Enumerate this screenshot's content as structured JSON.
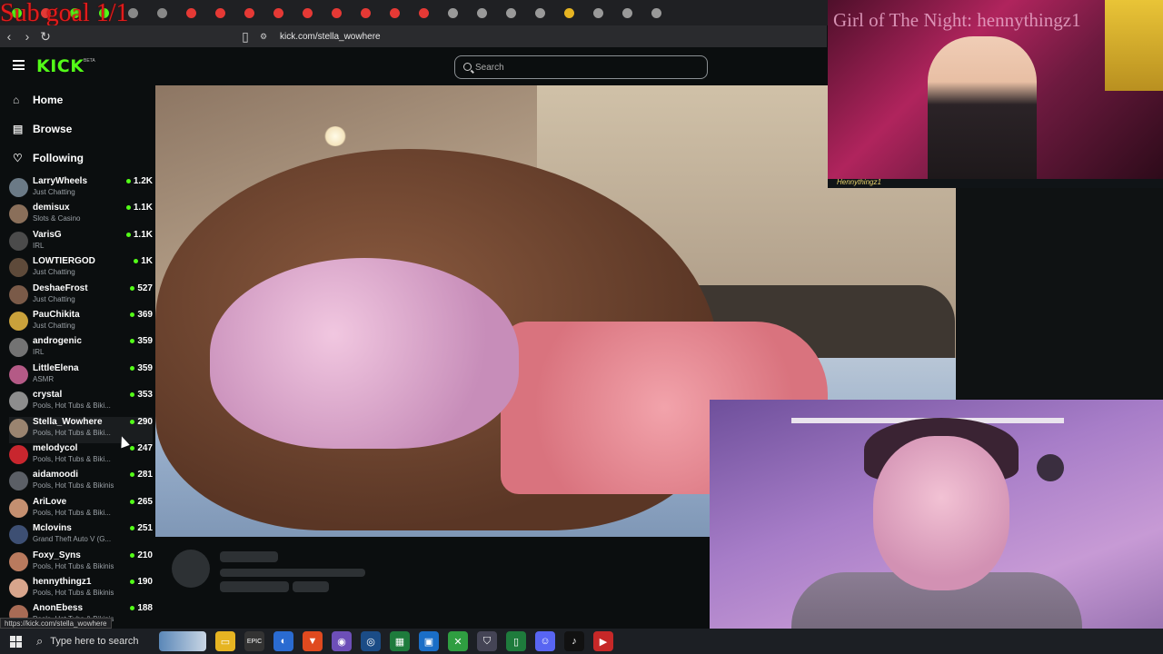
{
  "overlay": {
    "sub_goal": "Sub goal 1/1"
  },
  "browser": {
    "url": "kick.com/stella_wowhere",
    "status_url": "https://kick.com/stella_wowhere",
    "back": "‹",
    "forward": "›",
    "reload": "↻"
  },
  "header": {
    "logo": "KICK",
    "beta": "BETA",
    "search_placeholder": "Search"
  },
  "nav": [
    {
      "label": "Home",
      "icon": "home-icon"
    },
    {
      "label": "Browse",
      "icon": "browse-icon"
    },
    {
      "label": "Following",
      "icon": "heart-icon"
    }
  ],
  "channels": [
    {
      "name": "LarryWheels",
      "category": "Just Chatting",
      "viewers": "1.2K",
      "color": "#6b7a86"
    },
    {
      "name": "demisux",
      "category": "Slots & Casino",
      "viewers": "1.1K",
      "color": "#8a6f5a"
    },
    {
      "name": "VarisG",
      "category": "IRL",
      "viewers": "1.1K",
      "color": "#4b4b4b"
    },
    {
      "name": "LOWTIERGOD",
      "category": "Just Chatting",
      "viewers": "1K",
      "color": "#5e4a3a"
    },
    {
      "name": "DeshaeFrost",
      "category": "Just Chatting",
      "viewers": "527",
      "color": "#7a5a48"
    },
    {
      "name": "PauChikita",
      "category": "Just Chatting",
      "viewers": "369",
      "color": "#c9a13b"
    },
    {
      "name": "androgenic",
      "category": "IRL",
      "viewers": "359",
      "color": "#737373"
    },
    {
      "name": "LittleElena",
      "category": "ASMR",
      "viewers": "359",
      "color": "#b45a86"
    },
    {
      "name": "crystal",
      "category": "Pools, Hot Tubs & Biki...",
      "viewers": "353",
      "color": "#8d8d8d"
    },
    {
      "name": "Stella_Wowhere",
      "category": "Pools, Hot Tubs & Biki...",
      "viewers": "290",
      "color": "#9a8470"
    },
    {
      "name": "melodycol",
      "category": "Pools, Hot Tubs & Biki...",
      "viewers": "247",
      "color": "#c8262e"
    },
    {
      "name": "aidamoodi",
      "category": "Pools, Hot Tubs & Bikinis",
      "viewers": "281",
      "color": "#5b5f66"
    },
    {
      "name": "AriLove",
      "category": "Pools, Hot Tubs & Biki...",
      "viewers": "265",
      "color": "#c48f70"
    },
    {
      "name": "Mclovins",
      "category": "Grand Theft Auto V (G...",
      "viewers": "251",
      "color": "#3d4f73"
    },
    {
      "name": "Foxy_Syns",
      "category": "Pools, Hot Tubs & Bikinis",
      "viewers": "210",
      "color": "#b97a5e"
    },
    {
      "name": "hennythingz1",
      "category": "Pools, Hot Tubs & Bikinis",
      "viewers": "190",
      "color": "#d8a58c"
    },
    {
      "name": "AnonEbess",
      "category": "Pools, Hot Tubs & Bikinis",
      "viewers": "188",
      "color": "#a86b55"
    }
  ],
  "cam1": {
    "title": "Girl of The Night: hennythingz1",
    "signature": "Hennythingz1"
  },
  "taskbar": {
    "search_placeholder": "Type here to search"
  },
  "colors": {
    "accent": "#53fc18",
    "bg": "#0b0e0f"
  }
}
